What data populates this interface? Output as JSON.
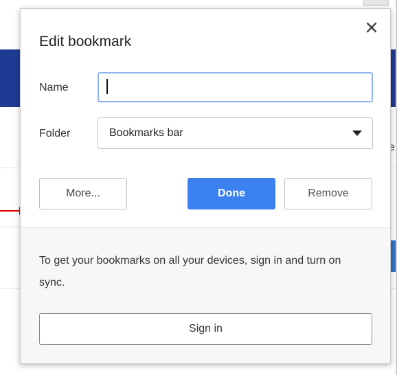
{
  "dialog": {
    "title": "Edit bookmark",
    "close_icon": "close-icon"
  },
  "fields": {
    "name_label": "Name",
    "name_value": "",
    "folder_label": "Folder",
    "folder_value": "Bookmarks bar"
  },
  "buttons": {
    "more_label": "More...",
    "done_label": "Done",
    "remove_label": "Remove"
  },
  "sync": {
    "message": "To get your bookmarks on all your devices, sign in and turn on sync.",
    "signin_label": "Sign in"
  },
  "background": {
    "partial_letter": "e"
  },
  "colors": {
    "accent": "#3b82f0",
    "focus_border": "#8fb3ec",
    "annotation_arrow": "#e00000"
  }
}
